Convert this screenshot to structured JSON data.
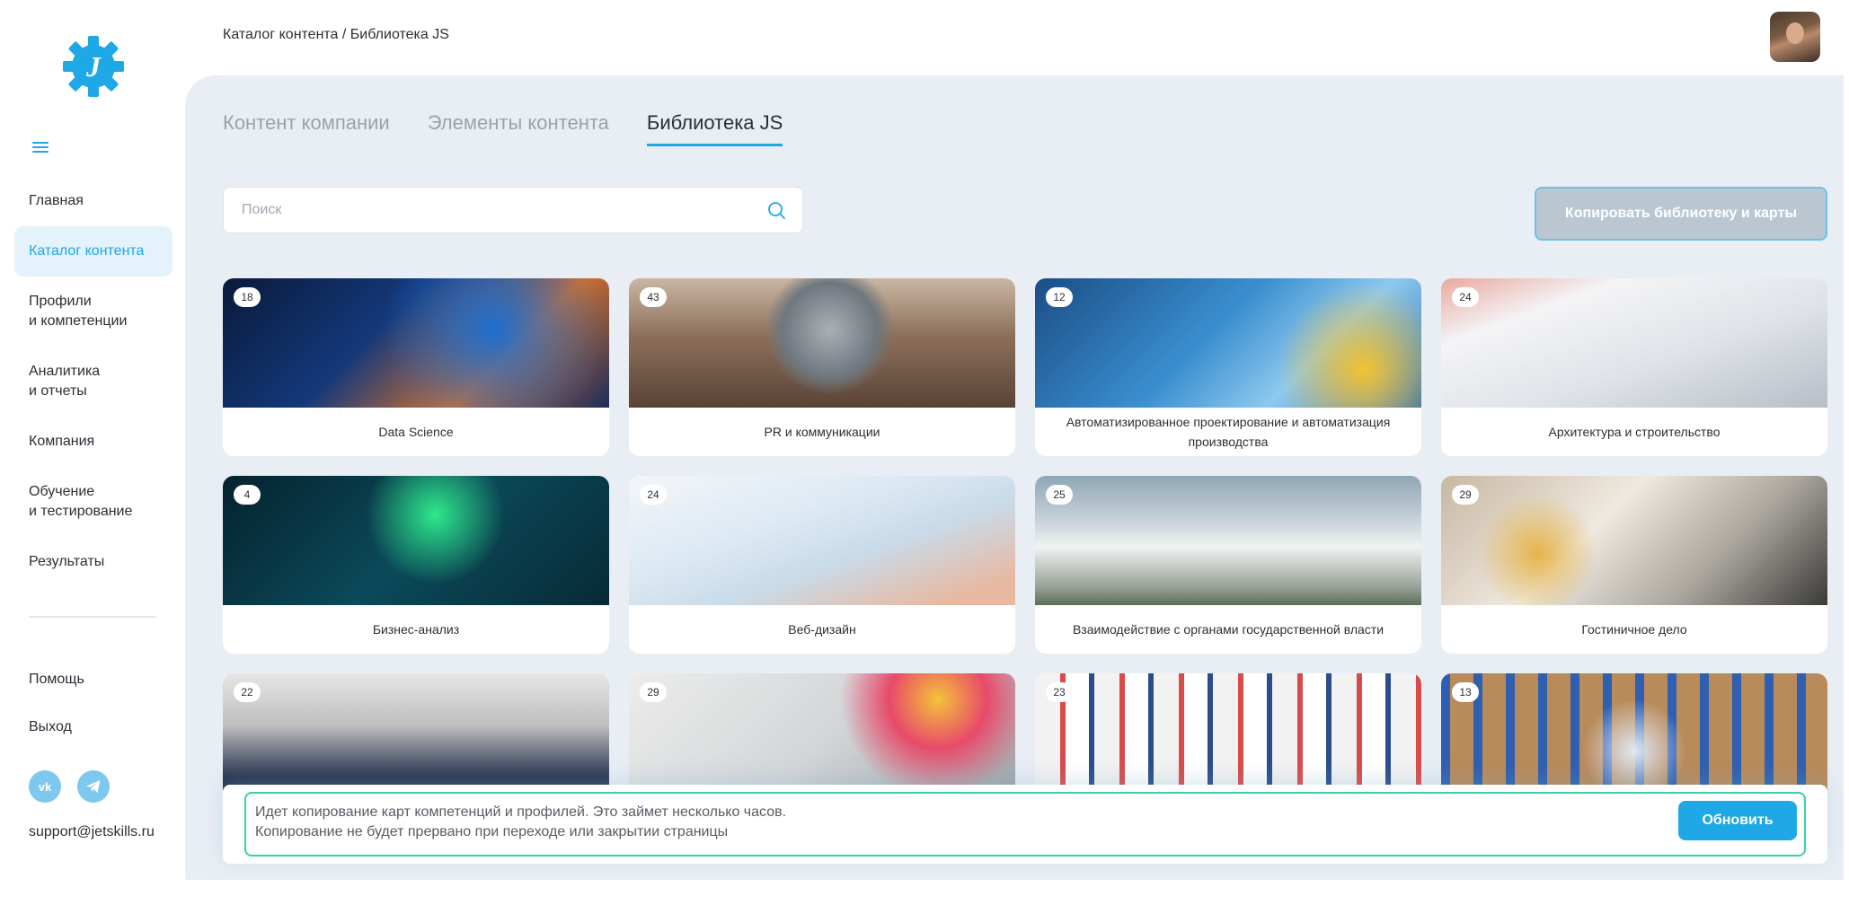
{
  "sidebar": {
    "logo_letter": "J",
    "nav": [
      {
        "label": "Главная"
      },
      {
        "label": "Каталог контента"
      },
      {
        "label_line1": "Профили",
        "label_line2": "и компетенции"
      },
      {
        "label_line1": "Аналитика",
        "label_line2": "и отчеты"
      },
      {
        "label": "Компания"
      },
      {
        "label_line1": "Обучение",
        "label_line2": "и тестирование"
      },
      {
        "label": "Результаты"
      }
    ],
    "help": "Помощь",
    "logout": "Выход",
    "social": {
      "vk": "vk",
      "telegram": "telegram-icon"
    },
    "support_email": "support@jetskills.ru"
  },
  "header": {
    "breadcrumb": "Каталог контента / Библиотека JS"
  },
  "main": {
    "tabs": [
      "Контент компании",
      "Элементы контента",
      "Библиотека JS"
    ],
    "active_tab": "Библиотека JS",
    "search_placeholder": "Поиск",
    "copy_button": "Копировать библиотеку и карты",
    "cards": [
      {
        "count": "18",
        "title": "Data Science"
      },
      {
        "count": "43",
        "title": "PR и коммуникации"
      },
      {
        "count": "12",
        "title": "Автоматизированное проектирование и автоматизация производства"
      },
      {
        "count": "24",
        "title": "Архитектура и строительство"
      },
      {
        "count": "4",
        "title": "Бизнес-анализ"
      },
      {
        "count": "24",
        "title": "Веб-дизайн"
      },
      {
        "count": "25",
        "title": "Взаимодействие с органами государственной власти"
      },
      {
        "count": "29",
        "title": "Гостиничное дело"
      },
      {
        "count": "22",
        "title": ""
      },
      {
        "count": "29",
        "title": ""
      },
      {
        "count": "23",
        "title": ""
      },
      {
        "count": "13",
        "title": ""
      }
    ],
    "notice": {
      "line1": "Идет копирование карт компетенций и профилей. Это займет несколько часов.",
      "line2": "Копирование не будет прервано при переходе или закрытии страницы",
      "button": "Обновить"
    }
  },
  "colors": {
    "accent": "#1fa8e6",
    "panel_bg": "#e9eef4",
    "active_nav_bg": "#e3f2fb",
    "notice_border": "#36d1a9",
    "copy_button_bg": "#bac7d1"
  }
}
